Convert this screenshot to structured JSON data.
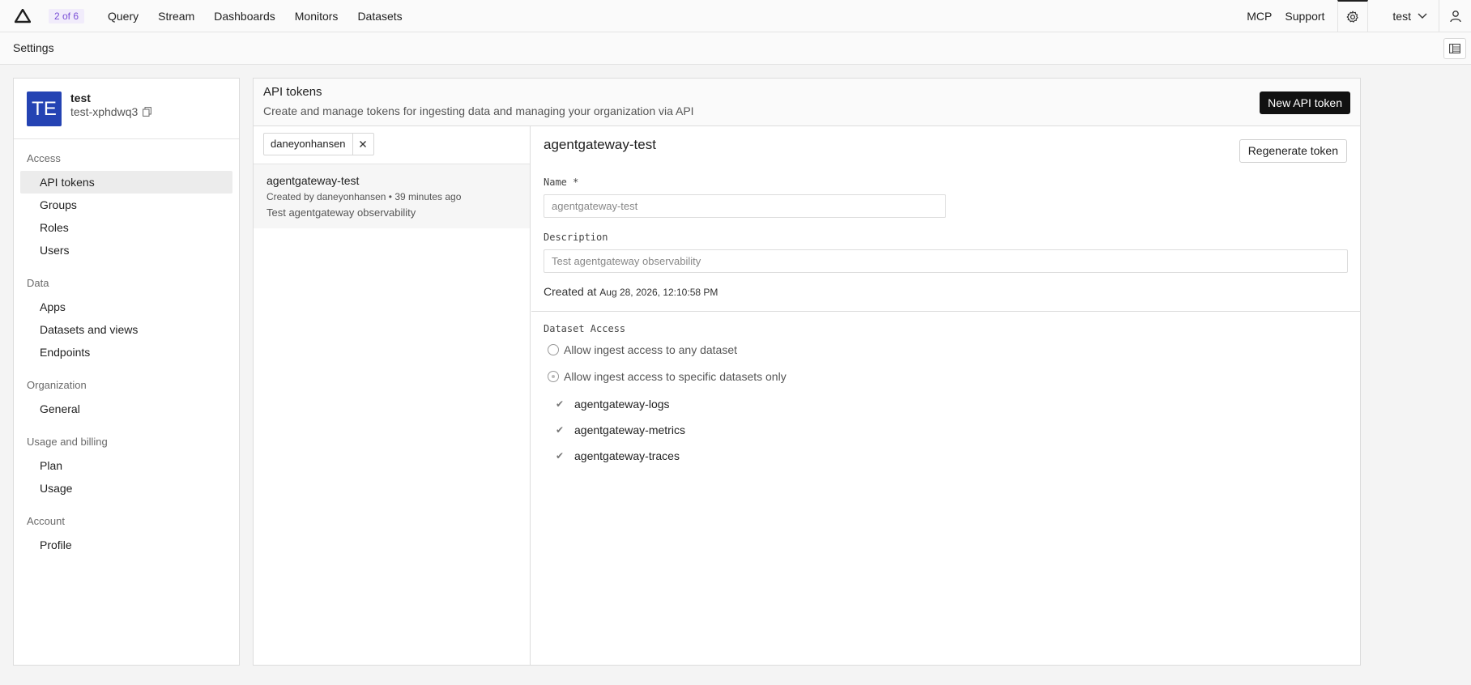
{
  "topbar": {
    "logo_icon": "axiom-logo-icon",
    "counter": "2 of 6",
    "nav": [
      "Query",
      "Stream",
      "Dashboards",
      "Monitors",
      "Datasets"
    ],
    "right_links": [
      "MCP",
      "Support"
    ],
    "settings_icon": "gear-icon",
    "user": "test",
    "user_icon": "person-icon"
  },
  "subbar": {
    "title": "Settings",
    "layout_icon": "table-layout-icon"
  },
  "org": {
    "avatar": "TE",
    "name": "test",
    "slug": "test-xphdwq3",
    "copy_icon": "copy-icon"
  },
  "sidebar": {
    "sections": [
      {
        "label": "Access",
        "items": [
          "API tokens",
          "Groups",
          "Roles",
          "Users"
        ]
      },
      {
        "label": "Data",
        "items": [
          "Apps",
          "Datasets and views",
          "Endpoints"
        ]
      },
      {
        "label": "Organization",
        "items": [
          "General"
        ]
      },
      {
        "label": "Usage and billing",
        "items": [
          "Plan",
          "Usage"
        ]
      },
      {
        "label": "Account",
        "items": [
          "Profile"
        ]
      }
    ],
    "active": "API tokens"
  },
  "main": {
    "title": "API tokens",
    "subtitle": "Create and manage tokens for ingesting data and managing your organization via API",
    "new_button": "New API token"
  },
  "filter": {
    "value": "daneyonhansen",
    "clear_icon": "close-icon"
  },
  "tokens": [
    {
      "name": "agentgateway-test",
      "meta": "Created by daneyonhansen • 39 minutes ago",
      "description": "Test agentgateway observability"
    }
  ],
  "detail": {
    "title": "agentgateway-test",
    "regenerate_button": "Regenerate token",
    "name_label": "Name *",
    "name_value": "agentgateway-test",
    "description_label": "Description",
    "description_value": "Test agentgateway observability",
    "created_label": "Created at",
    "created_value": "Aug 28, 2026, 12:10:58 PM",
    "access_label": "Dataset Access",
    "access_options": [
      "Allow ingest access to any dataset",
      "Allow ingest access to specific datasets only"
    ],
    "datasets": [
      "agentgateway-logs",
      "agentgateway-metrics",
      "agentgateway-traces"
    ]
  }
}
